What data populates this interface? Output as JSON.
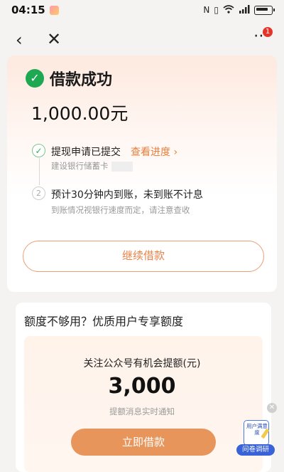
{
  "status_bar": {
    "time": "04:15",
    "right_icons": [
      "nfc-icon",
      "vibrate-icon",
      "wifi-icon",
      "signal-icon",
      "battery-icon"
    ]
  },
  "nav": {
    "back_icon": "‹",
    "close_icon": "✕",
    "more_icon": "⋯",
    "badge_count": "1"
  },
  "result": {
    "title": "借款成功",
    "amount": "1,000.00元",
    "steps": [
      {
        "title": "提现申请已提交",
        "link": "查看进度 ›",
        "subtitle": "建设银行储蓄卡",
        "status": "done"
      },
      {
        "number": "2",
        "title": "预计30分钟内到账，未到账不计息",
        "subtitle": "到账情况视银行速度而定，请注意查收",
        "status": "pending"
      }
    ],
    "continue_button": "继续借款"
  },
  "promo": {
    "heading": "额度不够用？优质用户专享额度",
    "text": "关注公众号有机会提额(元)",
    "amount": "3,000",
    "subtext": "提额消息实时通知",
    "button": "立即借款"
  },
  "survey": {
    "card_text": "用户满意度",
    "label": "问卷调研"
  },
  "colors": {
    "accent": "#e8844a",
    "success": "#1fa852",
    "button_fill": "#e7955a",
    "survey_blue": "#3a62d8"
  }
}
